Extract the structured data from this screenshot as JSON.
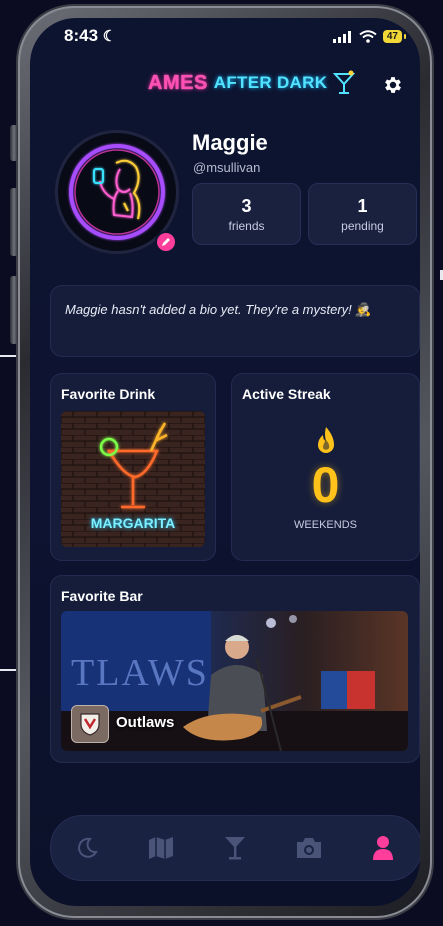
{
  "status": {
    "time": "8:43",
    "battery": "47"
  },
  "header": {
    "logo_left": "AMES",
    "logo_right": "AFTER DARK"
  },
  "profile": {
    "name": "Maggie",
    "handle": "@msullivan",
    "stats": [
      {
        "value": "3",
        "label": "friends"
      },
      {
        "value": "1",
        "label": "pending"
      }
    ],
    "bio": "Maggie hasn't added a bio yet. They're a mystery! 🕵️"
  },
  "favorite_drink": {
    "title": "Favorite Drink",
    "drink_sign": "MARGARITA"
  },
  "active_streak": {
    "title": "Active Streak",
    "count": "0",
    "unit": "WEEKENDS"
  },
  "favorite_bar": {
    "title": "Favorite Bar",
    "name": "Outlaws",
    "sign_text": "TLAWS"
  },
  "nav": {
    "items": [
      {
        "icon": "moon-icon",
        "active": false
      },
      {
        "icon": "map-icon",
        "active": false
      },
      {
        "icon": "cocktail-icon",
        "active": false
      },
      {
        "icon": "camera-icon",
        "active": false
      },
      {
        "icon": "person-icon",
        "active": true
      }
    ]
  },
  "colors": {
    "accent_pink": "#ff3d9a",
    "flame": "#ffc21a",
    "nav_inactive": "#4a5479"
  }
}
